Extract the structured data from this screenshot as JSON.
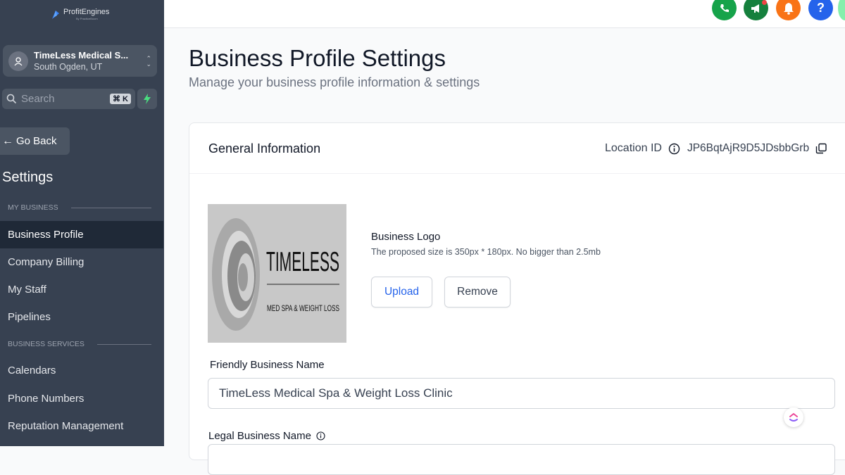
{
  "brand": {
    "name": "ProfitEngines",
    "tagline": "By PracticeBoom"
  },
  "location": {
    "name": "TimeLess Medical S...",
    "address": "South Ogden, UT"
  },
  "search": {
    "label": "Search",
    "shortcut": "⌘ K"
  },
  "sidebar": {
    "go_back": "Go Back",
    "settings_title": "Settings",
    "sections": [
      {
        "label": "MY BUSINESS",
        "items": [
          "Business Profile",
          "Company Billing",
          "My Staff",
          "Pipelines"
        ]
      },
      {
        "label": "BUSINESS SERVICES",
        "items": [
          "Calendars",
          "Phone Numbers",
          "Reputation Management"
        ]
      }
    ],
    "active_item": "Business Profile"
  },
  "topbar": {
    "icons": [
      "phone-icon",
      "megaphone-icon",
      "bell-icon",
      "help-icon"
    ],
    "colors": {
      "phone": "#16a34a",
      "megaphone": "#15803d",
      "bell": "#f97316",
      "help": "#2563eb"
    }
  },
  "page": {
    "title": "Business Profile Settings",
    "subtitle": "Manage your business profile information & settings"
  },
  "card": {
    "title": "General Information",
    "location_id_label": "Location ID",
    "location_id_value": "JP6BqtAjR9D5JDsbbGrb",
    "logo_image": {
      "wordmark": "TIMELESS",
      "tagline": "MED SPA & WEIGHT LOSS"
    },
    "logo_title": "Business Logo",
    "logo_desc": "The proposed size is 350px * 180px. No bigger than 2.5mb",
    "upload_label": "Upload",
    "remove_label": "Remove",
    "friendly_label": "Friendly Business Name",
    "friendly_value": "TimeLess Medical Spa & Weight Loss Clinic",
    "legal_label": "Legal Business Name"
  }
}
